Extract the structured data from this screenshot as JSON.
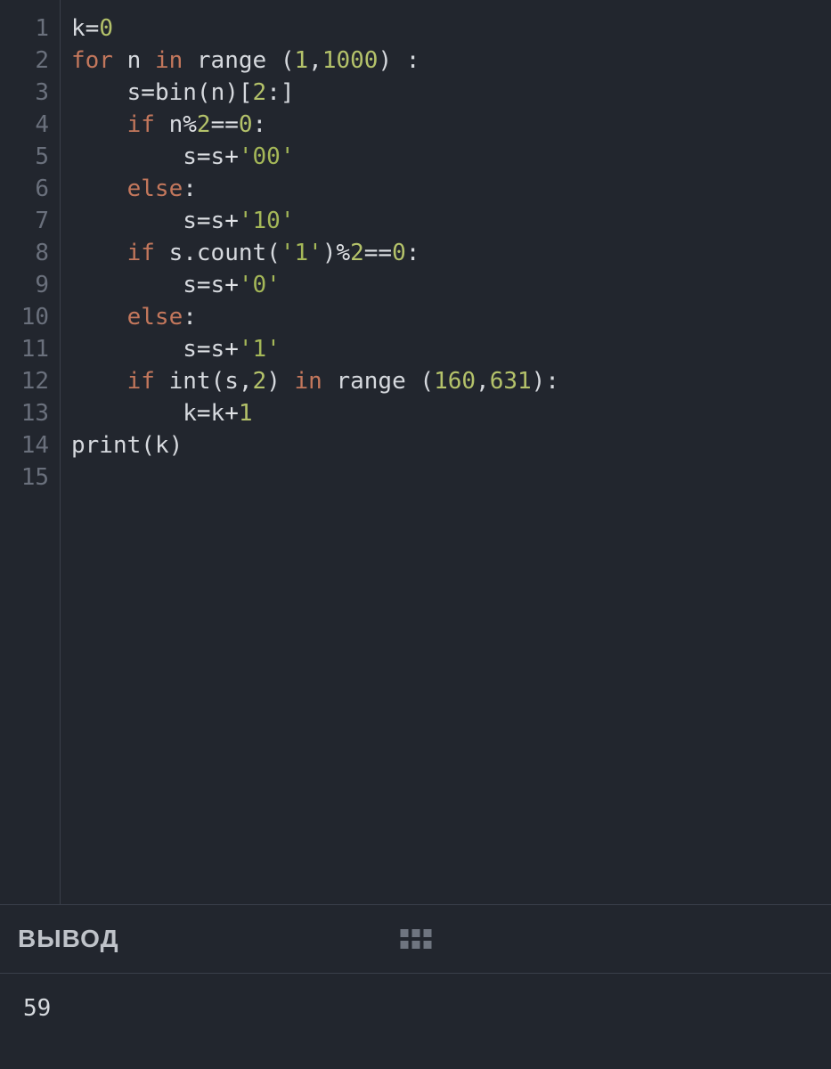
{
  "editor": {
    "lineNumbers": [
      "1",
      "2",
      "3",
      "4",
      "5",
      "6",
      "7",
      "8",
      "9",
      "10",
      "11",
      "12",
      "13",
      "14",
      "15"
    ],
    "lines": [
      [
        {
          "cls": "tok-id",
          "t": "k"
        },
        {
          "cls": "tok-op",
          "t": "="
        },
        {
          "cls": "tok-num",
          "t": "0"
        }
      ],
      [
        {
          "cls": "tok-kw",
          "t": "for"
        },
        {
          "cls": "",
          "t": " "
        },
        {
          "cls": "tok-id",
          "t": "n"
        },
        {
          "cls": "",
          "t": " "
        },
        {
          "cls": "tok-kw",
          "t": "in"
        },
        {
          "cls": "",
          "t": " "
        },
        {
          "cls": "tok-call",
          "t": "range"
        },
        {
          "cls": "",
          "t": " "
        },
        {
          "cls": "tok-punc",
          "t": "("
        },
        {
          "cls": "tok-num",
          "t": "1"
        },
        {
          "cls": "tok-punc",
          "t": ","
        },
        {
          "cls": "tok-num",
          "t": "1000"
        },
        {
          "cls": "tok-punc",
          "t": ")"
        },
        {
          "cls": "",
          "t": " "
        },
        {
          "cls": "tok-punc",
          "t": ":"
        }
      ],
      [
        {
          "cls": "",
          "t": "    "
        },
        {
          "cls": "tok-id",
          "t": "s"
        },
        {
          "cls": "tok-op",
          "t": "="
        },
        {
          "cls": "tok-call",
          "t": "bin"
        },
        {
          "cls": "tok-punc",
          "t": "("
        },
        {
          "cls": "tok-id",
          "t": "n"
        },
        {
          "cls": "tok-punc",
          "t": ")["
        },
        {
          "cls": "tok-num",
          "t": "2"
        },
        {
          "cls": "tok-punc",
          "t": ":]"
        }
      ],
      [
        {
          "cls": "",
          "t": "    "
        },
        {
          "cls": "tok-kw",
          "t": "if"
        },
        {
          "cls": "",
          "t": " "
        },
        {
          "cls": "tok-id",
          "t": "n"
        },
        {
          "cls": "tok-op",
          "t": "%"
        },
        {
          "cls": "tok-num",
          "t": "2"
        },
        {
          "cls": "tok-op",
          "t": "=="
        },
        {
          "cls": "tok-num",
          "t": "0"
        },
        {
          "cls": "tok-punc",
          "t": ":"
        }
      ],
      [
        {
          "cls": "",
          "t": "        "
        },
        {
          "cls": "tok-id",
          "t": "s"
        },
        {
          "cls": "tok-op",
          "t": "="
        },
        {
          "cls": "tok-id",
          "t": "s"
        },
        {
          "cls": "tok-op",
          "t": "+"
        },
        {
          "cls": "tok-str",
          "t": "'00'"
        }
      ],
      [
        {
          "cls": "",
          "t": "    "
        },
        {
          "cls": "tok-kw",
          "t": "else"
        },
        {
          "cls": "tok-punc",
          "t": ":"
        }
      ],
      [
        {
          "cls": "",
          "t": "        "
        },
        {
          "cls": "tok-id",
          "t": "s"
        },
        {
          "cls": "tok-op",
          "t": "="
        },
        {
          "cls": "tok-id",
          "t": "s"
        },
        {
          "cls": "tok-op",
          "t": "+"
        },
        {
          "cls": "tok-str",
          "t": "'10'"
        }
      ],
      [
        {
          "cls": "",
          "t": "    "
        },
        {
          "cls": "tok-kw",
          "t": "if"
        },
        {
          "cls": "",
          "t": " "
        },
        {
          "cls": "tok-id",
          "t": "s"
        },
        {
          "cls": "tok-punc",
          "t": "."
        },
        {
          "cls": "tok-call",
          "t": "count"
        },
        {
          "cls": "tok-punc",
          "t": "("
        },
        {
          "cls": "tok-str",
          "t": "'1'"
        },
        {
          "cls": "tok-punc",
          "t": ")"
        },
        {
          "cls": "tok-op",
          "t": "%"
        },
        {
          "cls": "tok-num",
          "t": "2"
        },
        {
          "cls": "tok-op",
          "t": "=="
        },
        {
          "cls": "tok-num",
          "t": "0"
        },
        {
          "cls": "tok-punc",
          "t": ":"
        }
      ],
      [
        {
          "cls": "",
          "t": "        "
        },
        {
          "cls": "tok-id",
          "t": "s"
        },
        {
          "cls": "tok-op",
          "t": "="
        },
        {
          "cls": "tok-id",
          "t": "s"
        },
        {
          "cls": "tok-op",
          "t": "+"
        },
        {
          "cls": "tok-str",
          "t": "'0'"
        }
      ],
      [
        {
          "cls": "",
          "t": "    "
        },
        {
          "cls": "tok-kw",
          "t": "else"
        },
        {
          "cls": "tok-punc",
          "t": ":"
        }
      ],
      [
        {
          "cls": "",
          "t": "        "
        },
        {
          "cls": "tok-id",
          "t": "s"
        },
        {
          "cls": "tok-op",
          "t": "="
        },
        {
          "cls": "tok-id",
          "t": "s"
        },
        {
          "cls": "tok-op",
          "t": "+"
        },
        {
          "cls": "tok-str",
          "t": "'1'"
        }
      ],
      [
        {
          "cls": "",
          "t": "    "
        },
        {
          "cls": "tok-kw",
          "t": "if"
        },
        {
          "cls": "",
          "t": " "
        },
        {
          "cls": "tok-call",
          "t": "int"
        },
        {
          "cls": "tok-punc",
          "t": "("
        },
        {
          "cls": "tok-id",
          "t": "s"
        },
        {
          "cls": "tok-punc",
          "t": ","
        },
        {
          "cls": "tok-num",
          "t": "2"
        },
        {
          "cls": "tok-punc",
          "t": ")"
        },
        {
          "cls": "",
          "t": " "
        },
        {
          "cls": "tok-kw",
          "t": "in"
        },
        {
          "cls": "",
          "t": " "
        },
        {
          "cls": "tok-call",
          "t": "range"
        },
        {
          "cls": "",
          "t": " "
        },
        {
          "cls": "tok-punc",
          "t": "("
        },
        {
          "cls": "tok-num",
          "t": "160"
        },
        {
          "cls": "tok-punc",
          "t": ","
        },
        {
          "cls": "tok-num",
          "t": "631"
        },
        {
          "cls": "tok-punc",
          "t": "):"
        }
      ],
      [
        {
          "cls": "",
          "t": "        "
        },
        {
          "cls": "tok-id",
          "t": "k"
        },
        {
          "cls": "tok-op",
          "t": "="
        },
        {
          "cls": "tok-id",
          "t": "k"
        },
        {
          "cls": "tok-op",
          "t": "+"
        },
        {
          "cls": "tok-num",
          "t": "1"
        }
      ],
      [
        {
          "cls": "tok-call",
          "t": "print"
        },
        {
          "cls": "tok-punc",
          "t": "("
        },
        {
          "cls": "tok-id",
          "t": "k"
        },
        {
          "cls": "tok-punc",
          "t": ")"
        }
      ],
      []
    ]
  },
  "output": {
    "title": "ВЫВОД",
    "value": "59"
  }
}
